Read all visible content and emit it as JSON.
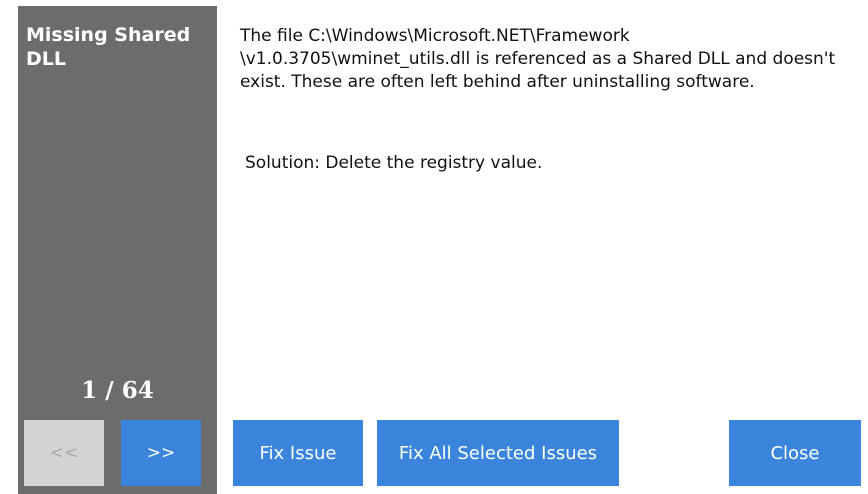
{
  "sidebar": {
    "title": "Missing Shared DLL",
    "counter": "1 / 64",
    "prev_label": "<<",
    "next_label": ">>"
  },
  "issue": {
    "description": "The file C:\\Windows\\Microsoft.NET\\Framework \\v1.0.3705\\wminet_utils.dll is referenced as a Shared DLL and doesn't exist. These are often left behind after uninstalling software.",
    "solution": "Solution: Delete the registry value."
  },
  "buttons": {
    "fix_issue": "Fix Issue",
    "fix_all": "Fix All Selected Issues",
    "close": "Close"
  },
  "colors": {
    "sidebar_bg": "#6c6c6c",
    "accent_blue": "#3a84dc",
    "disabled_gray": "#d4d4d4"
  }
}
